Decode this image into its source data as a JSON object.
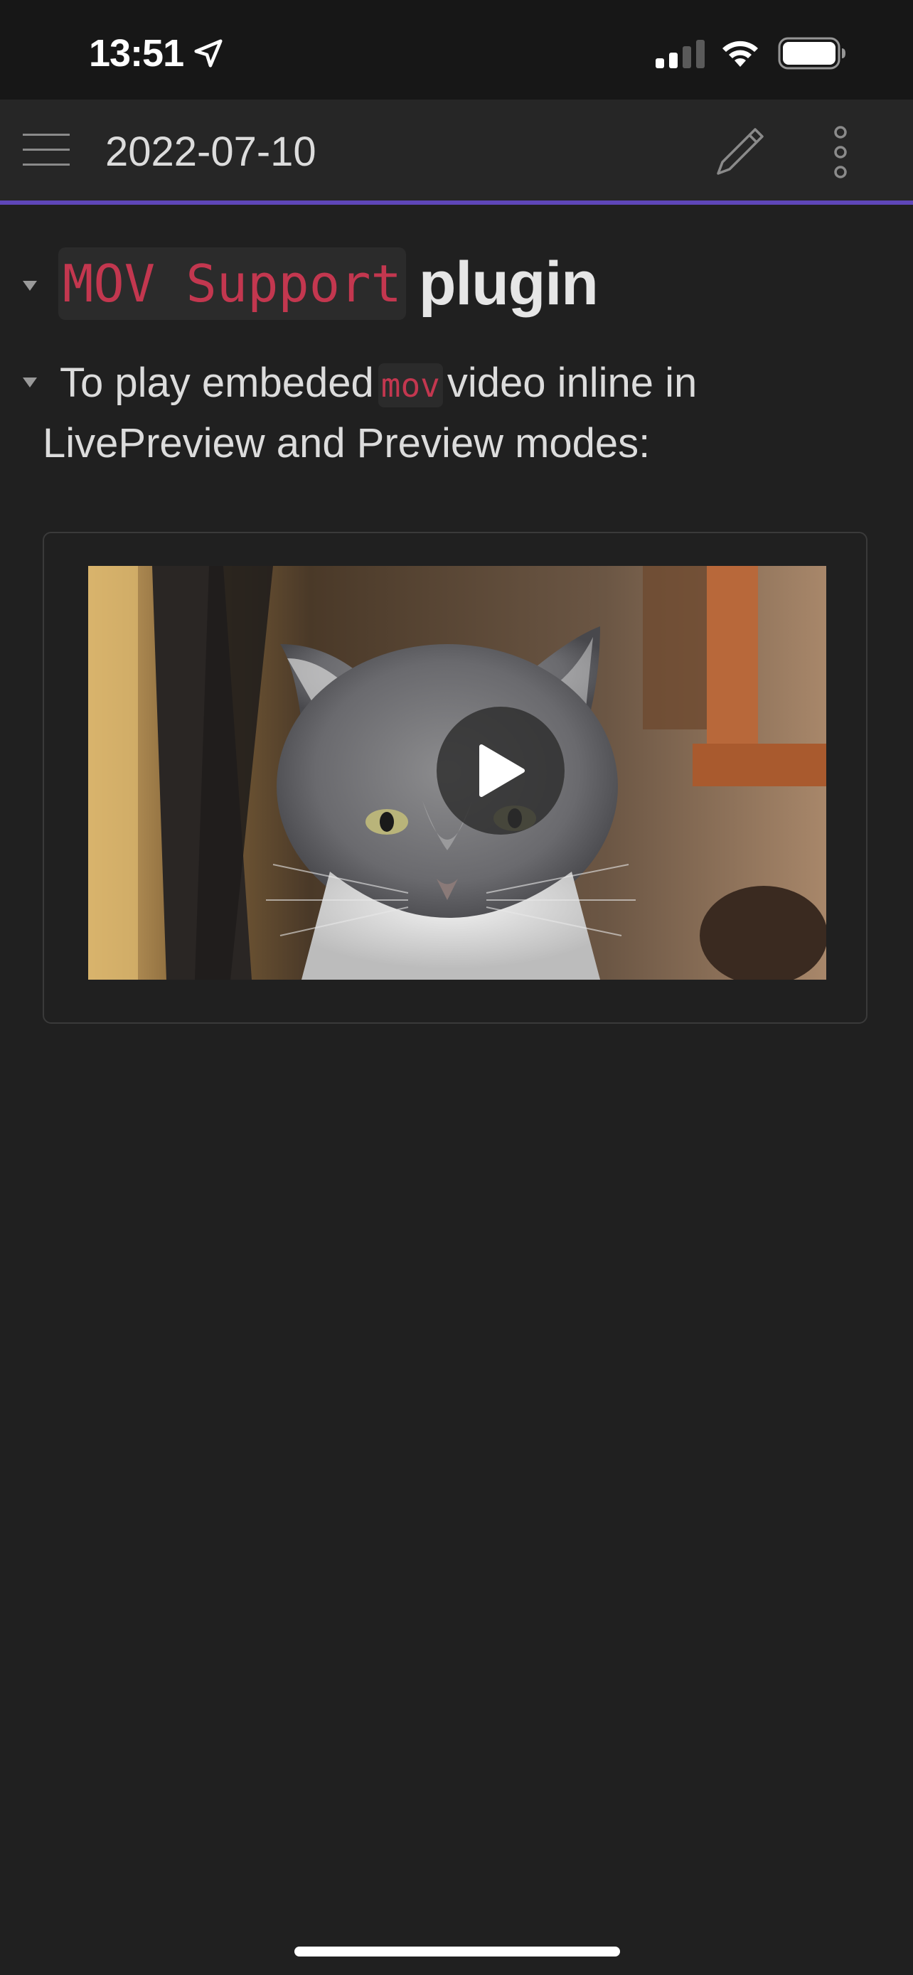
{
  "status_bar": {
    "time": "13:51",
    "icons": [
      "location-arrow-icon",
      "cellular-signal-icon",
      "wifi-icon",
      "battery-icon"
    ]
  },
  "header": {
    "title": "2022-07-10",
    "icons": [
      "menu-icon",
      "pencil-icon",
      "more-vertical-icon"
    ],
    "accent_color": "#5e46b8"
  },
  "note": {
    "heading": {
      "code": "MOV Support",
      "text": "plugin"
    },
    "paragraph": {
      "text_before": "To play embeded",
      "code": "mov",
      "text_after": "video inline in LivePreview and Preview modes:"
    },
    "video": {
      "play_icon": "play-icon",
      "state": "paused"
    }
  },
  "colors": {
    "background": "#202020",
    "code_text": "#c3374f",
    "code_background": "#2b2b2b"
  }
}
